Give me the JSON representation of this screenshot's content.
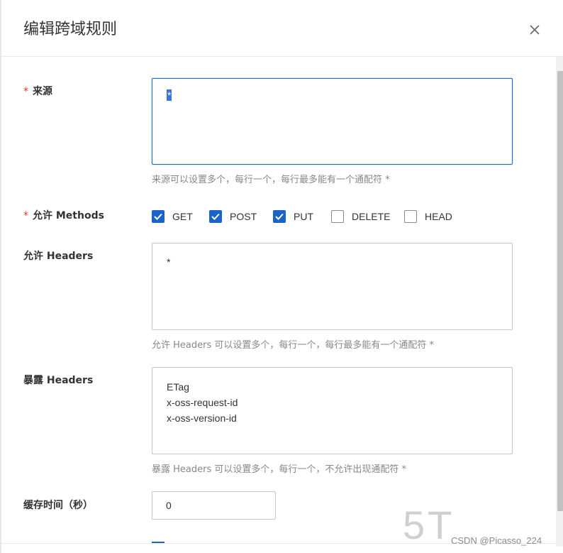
{
  "dialog": {
    "title": "编辑跨域规则",
    "close_icon": "close-icon"
  },
  "form": {
    "required_mark": "*",
    "origin": {
      "label": "来源",
      "value": "*",
      "help": "来源可以设置多个，每行一个，每行最多能有一个通配符 *"
    },
    "methods": {
      "label": "允许 Methods",
      "options": [
        {
          "label": "GET",
          "checked": true
        },
        {
          "label": "POST",
          "checked": true
        },
        {
          "label": "PUT",
          "checked": true
        },
        {
          "label": "DELETE",
          "checked": false
        },
        {
          "label": "HEAD",
          "checked": false
        }
      ]
    },
    "allow_headers": {
      "label": "允许 Headers",
      "value": "*",
      "help": "允许 Headers 可以设置多个，每行一个，每行最多能有一个通配符 *"
    },
    "expose_headers": {
      "label": "暴露 Headers",
      "lines": [
        "ETag",
        "x-oss-request-id",
        "x-oss-version-id"
      ],
      "help": "暴露 Headers 可以设置多个，每行一个，不允许出现通配符 *"
    },
    "cache_time": {
      "label": "缓存时间（秒）",
      "value": "0"
    }
  },
  "watermark": {
    "logo": "5T",
    "text": "CSDN @Picasso_224"
  },
  "colors": {
    "accent": "#1a64c8",
    "required": "#e0382b",
    "help_text": "#888888"
  }
}
